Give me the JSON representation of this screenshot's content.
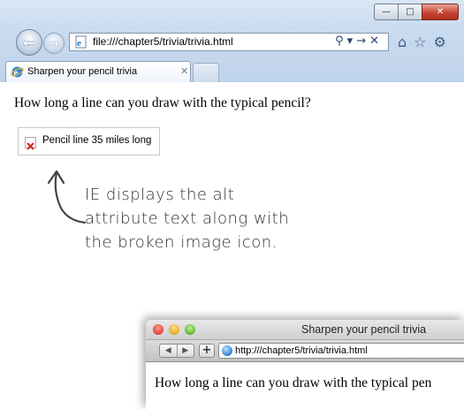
{
  "ie": {
    "address_url": "file:///chapter5/trivia/trivia.html",
    "tab_title": "Sharpen your pencil trivia",
    "question": "How long a line can you draw with the typical pencil?",
    "alt_text": "Pencil line 35 miles long",
    "icons": [
      "back-arrow-icon",
      "forward-arrow-icon",
      "ie-page-icon",
      "search-icon",
      "refresh-icon",
      "stop-icon",
      "home-icon",
      "favorites-star-icon",
      "settings-gear-icon",
      "broken-image-icon"
    ]
  },
  "annotation": {
    "lines": [
      "IE displays the alt",
      "attribute text along with",
      "the broken image icon."
    ]
  },
  "safari": {
    "window_title": "Sharpen your pencil trivia",
    "address_url": "http:///chapter5/trivia/trivia.html",
    "question": "How long a line can you draw with the typical pen"
  }
}
